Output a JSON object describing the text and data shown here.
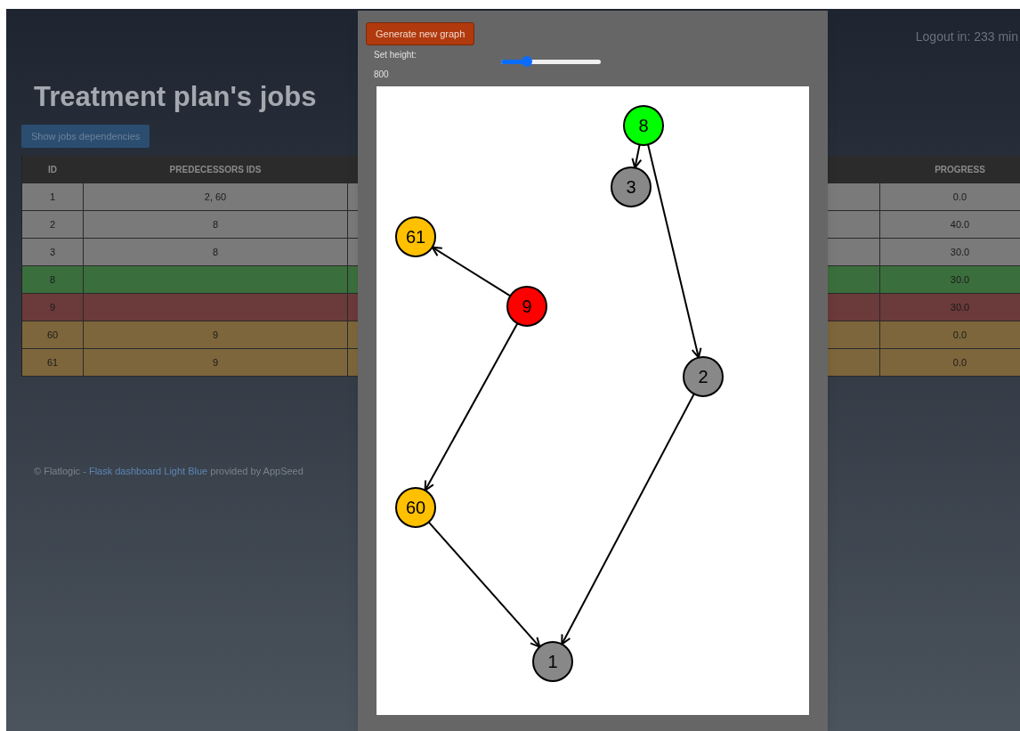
{
  "header": {
    "logout": "Logout in: 233 min"
  },
  "page": {
    "title": "Treatment plan's jobs",
    "dependencies_button": "Show jobs dependencies"
  },
  "table": {
    "columns": [
      "ID",
      "PREDECESSORS IDS",
      "PROGRESS"
    ],
    "rows": [
      {
        "id": "1",
        "predecessors": "2, 60",
        "progress": "0.0",
        "color": "#7a7a7a"
      },
      {
        "id": "2",
        "predecessors": "8",
        "progress": "40.0",
        "color": "#7a7a7a"
      },
      {
        "id": "3",
        "predecessors": "8",
        "progress": "30.0",
        "color": "#7a7a7a"
      },
      {
        "id": "8",
        "progress": "30.0",
        "color": "#3b6e3d"
      },
      {
        "id": "9",
        "progress": "30.0",
        "color": "#6b3a3a"
      },
      {
        "id": "60",
        "predecessors": "9",
        "progress": "0.0",
        "color": "#7d663b"
      },
      {
        "id": "61",
        "predecessors": "9",
        "progress": "0.0",
        "color": "#7d663b"
      }
    ]
  },
  "footer": {
    "prefix": "© Flatlogic - ",
    "link": "Flask dashboard Light Blue",
    "suffix": " provided by AppSeed"
  },
  "modal": {
    "generate_button": "Generate new graph",
    "height_label": "Set height:",
    "height_value": "800",
    "height_slider": {
      "level": 0.24
    },
    "graph": {
      "nodes": [
        {
          "label": "8",
          "color": "#00ff00"
        },
        {
          "label": "3",
          "color": "#888888"
        },
        {
          "label": "61",
          "color": "#ffc000"
        },
        {
          "label": "9",
          "color": "#ff0000"
        },
        {
          "label": "2",
          "color": "#888888"
        },
        {
          "label": "60",
          "color": "#ffc000"
        },
        {
          "label": "1",
          "color": "#888888"
        }
      ]
    }
  }
}
